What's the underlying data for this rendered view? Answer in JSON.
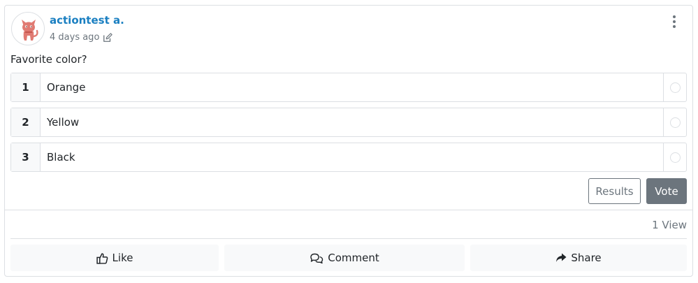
{
  "post": {
    "author": "actiontest a.",
    "time": "4 days ago",
    "question": "Favorite color?"
  },
  "poll": {
    "options": [
      {
        "number": "1",
        "label": "Orange"
      },
      {
        "number": "2",
        "label": "Yellow"
      },
      {
        "number": "3",
        "label": "Black"
      }
    ],
    "results_label": "Results",
    "vote_label": "Vote"
  },
  "stats": {
    "views": "1 View"
  },
  "actions": {
    "like_label": "Like",
    "comment_label": "Comment",
    "share_label": "Share"
  },
  "icons": {
    "avatar": "cat-avatar-icon",
    "edit": "edit-pencil-icon",
    "menu": "kebab-menu-icon",
    "like": "thumbs-up-icon",
    "comment": "comments-icon",
    "share": "share-arrow-icon"
  },
  "colors": {
    "accent_link": "#1a7fc1",
    "secondary": "#6c757d",
    "avatar_fill": "#e07a72"
  }
}
